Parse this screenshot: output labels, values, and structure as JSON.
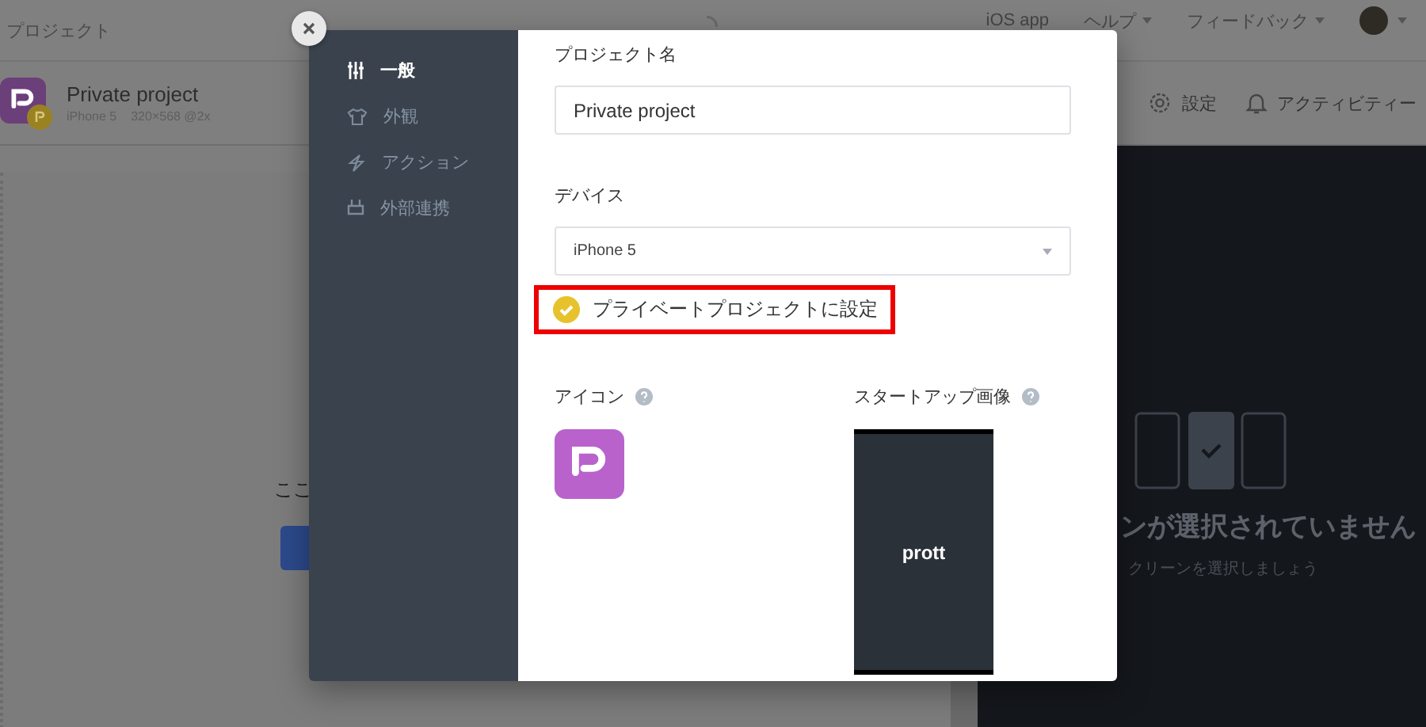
{
  "topbar": {
    "title": "プロジェクト",
    "menu": [
      {
        "label": "iOS app",
        "dropdown": false
      },
      {
        "label": "ヘルプ",
        "dropdown": true
      },
      {
        "label": "フィードバック",
        "dropdown": true
      }
    ]
  },
  "project": {
    "name": "Private project",
    "device": "iPhone 5",
    "resolution": "320×568 @2x"
  },
  "toolbar": [
    {
      "kind": "settings",
      "label": "設定"
    },
    {
      "kind": "activity",
      "label": "アクティビティー"
    }
  ],
  "canvas": {
    "hint": "ここ"
  },
  "preview_panel": {
    "title": "ンが選択されていません",
    "subtitle": "クリーンを選択しましょう"
  },
  "modal": {
    "nav": [
      {
        "kind": "general",
        "label": "一般",
        "selected": true
      },
      {
        "kind": "appearance",
        "label": "外観",
        "selected": false
      },
      {
        "kind": "action",
        "label": "アクション",
        "selected": false
      },
      {
        "kind": "integration",
        "label": "外部連携",
        "selected": false
      }
    ],
    "project_name": {
      "label": "プロジェクト名",
      "value": "Private project"
    },
    "device": {
      "label": "デバイス",
      "value": "iPhone 5"
    },
    "private": {
      "label": "プライベートプロジェクトに設定",
      "checked": true
    },
    "icon": {
      "label": "アイコン"
    },
    "startup": {
      "label": "スタートアップ画像",
      "logo": "prott"
    }
  }
}
